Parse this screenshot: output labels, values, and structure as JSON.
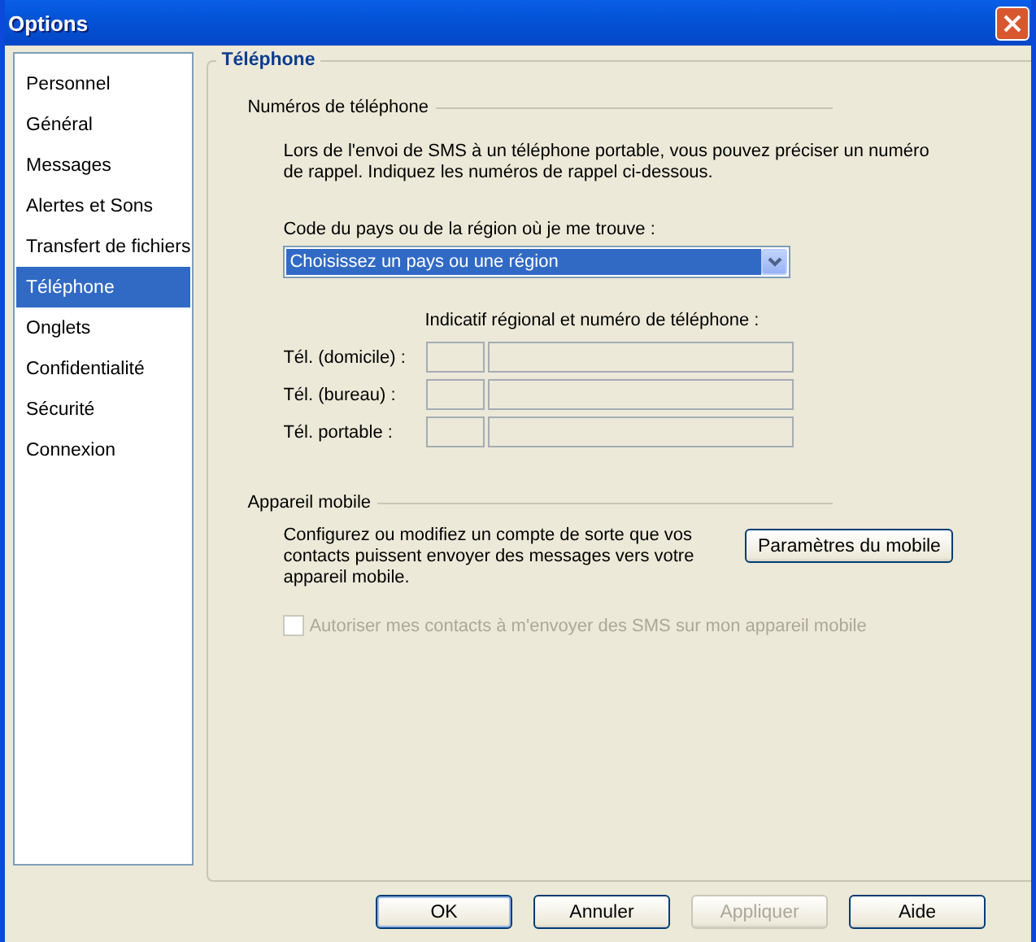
{
  "window": {
    "title": "Options"
  },
  "sidebar": {
    "items": [
      {
        "label": "Personnel",
        "selected": false
      },
      {
        "label": "Général",
        "selected": false
      },
      {
        "label": "Messages",
        "selected": false
      },
      {
        "label": "Alertes et Sons",
        "selected": false
      },
      {
        "label": "Transfert de fichiers",
        "selected": false
      },
      {
        "label": "Téléphone",
        "selected": true
      },
      {
        "label": "Onglets",
        "selected": false
      },
      {
        "label": "Confidentialité",
        "selected": false
      },
      {
        "label": "Sécurité",
        "selected": false
      },
      {
        "label": "Connexion",
        "selected": false
      }
    ]
  },
  "panel": {
    "title": "Téléphone",
    "phone_numbers": {
      "heading": "Numéros de téléphone",
      "description": "Lors de l'envoi de SMS à un téléphone portable, vous pouvez préciser un numéro de rappel. Indiquez les numéros de rappel ci-dessous.",
      "country_label": "Code du pays ou de la région où je me trouve :",
      "country_select": {
        "value": "Choisissez un pays ou une région"
      },
      "numbers_label": "Indicatif régional et numéro de téléphone :",
      "rows": [
        {
          "label": "Tél. (domicile) :",
          "disabled": true
        },
        {
          "label": "Tél. (bureau) :",
          "disabled": true
        },
        {
          "label": "Tél. portable :",
          "disabled": true
        }
      ]
    },
    "mobile": {
      "heading": "Appareil mobile",
      "description": "Configurez ou modifiez un compte de sorte que vos contacts puissent envoyer des messages vers votre appareil mobile.",
      "button": "Paramètres du mobile",
      "checkbox": {
        "label": "Autoriser mes contacts à m'envoyer des SMS sur mon appareil mobile",
        "checked": false,
        "disabled": true
      }
    }
  },
  "buttons": [
    {
      "label": "OK",
      "default": true,
      "disabled": false
    },
    {
      "label": "Annuler",
      "default": false,
      "disabled": false
    },
    {
      "label": "Appliquer",
      "default": false,
      "disabled": true
    },
    {
      "label": "Aide",
      "default": false,
      "disabled": false
    }
  ]
}
